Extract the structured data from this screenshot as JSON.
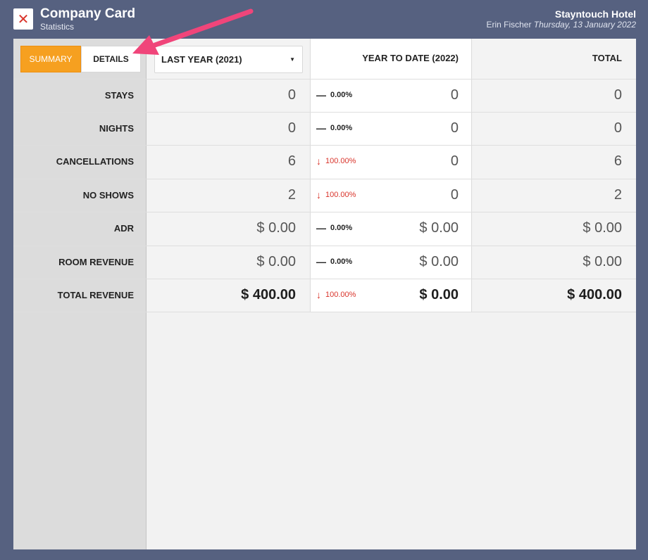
{
  "header": {
    "title": "Company Card",
    "subtitle": "Statistics",
    "hotel": "Stayntouch Hotel",
    "user": "Erin Fischer",
    "date": "Thursday, 13 January 2022",
    "close_icon": "close-icon"
  },
  "toggle": {
    "summary": "SUMMARY",
    "details": "DETAILS",
    "active": "summary"
  },
  "select": {
    "value": "LAST YEAR (2021)"
  },
  "columns": {
    "ytd": "YEAR TO DATE (2022)",
    "total": "TOTAL"
  },
  "rows": [
    {
      "label": "STAYS",
      "last_year": "0",
      "change": "0.00%",
      "trend": "flat",
      "ytd": "0",
      "total": "0"
    },
    {
      "label": "NIGHTS",
      "last_year": "0",
      "change": "0.00%",
      "trend": "flat",
      "ytd": "0",
      "total": "0"
    },
    {
      "label": "CANCELLATIONS",
      "last_year": "6",
      "change": "100.00%",
      "trend": "down",
      "ytd": "0",
      "total": "6"
    },
    {
      "label": "NO SHOWS",
      "last_year": "2",
      "change": "100.00%",
      "trend": "down",
      "ytd": "0",
      "total": "2"
    },
    {
      "label": "ADR",
      "last_year": "$ 0.00",
      "change": "0.00%",
      "trend": "flat",
      "ytd": "$ 0.00",
      "total": "$ 0.00"
    },
    {
      "label": "ROOM REVENUE",
      "last_year": "$ 0.00",
      "change": "0.00%",
      "trend": "flat",
      "ytd": "$ 0.00",
      "total": "$ 0.00"
    },
    {
      "label": "TOTAL REVENUE",
      "last_year": "$ 400.00",
      "change": "100.00%",
      "trend": "down",
      "ytd": "$ 0.00",
      "total": "$ 400.00"
    }
  ],
  "colors": {
    "accent": "#f6a020",
    "down": "#d9342b",
    "background": "#566180",
    "annotation_arrow": "#f0457a"
  }
}
